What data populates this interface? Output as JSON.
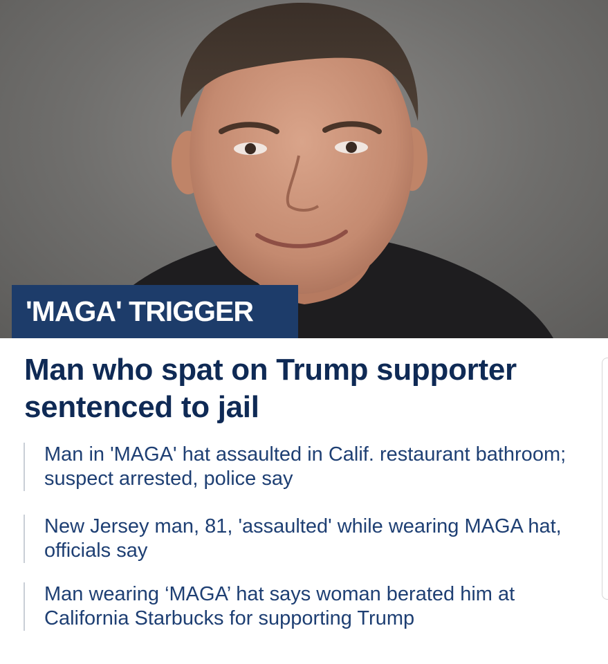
{
  "hero": {
    "photo_icon": "mugshot-photo",
    "category_tag": "'MAGA' TRIGGER"
  },
  "article": {
    "headline": "Man who spat on Trump supporter sentenced to jail"
  },
  "related": [
    {
      "title": "Man in 'MAGA' hat assaulted in Calif. restaurant bathroom; suspect arrested, police say"
    },
    {
      "title": "New Jersey man, 81, 'assaulted' while wearing MAGA hat, officials say"
    },
    {
      "title": "Man wearing ‘MAGA’ hat says woman berated him at California Starbucks for supporting Trump"
    }
  ],
  "colors": {
    "tag_bg": "#1d3c6a",
    "headline": "#0f2a55",
    "related_text": "#1e3f73"
  }
}
